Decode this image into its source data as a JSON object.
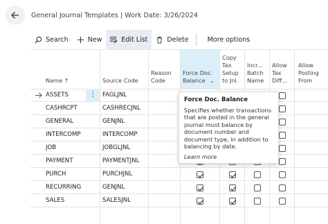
{
  "header": {
    "title": "General Journal Templates | Work Date: 3/26/2024"
  },
  "actions": {
    "search": "Search",
    "new": "New",
    "edit_list": "Edit List",
    "delete": "Delete",
    "more_options": "More options"
  },
  "columns": {
    "name": "Name ↑",
    "source_code": "Source Code",
    "reason_code_1": "Reason",
    "reason_code_2": "Code",
    "force_1": "Force Doc.",
    "force_2": "Balance",
    "copy_1": "Copy",
    "copy_2": "Tax",
    "copy_3": "Setup",
    "copy_4": "to Jnl.",
    "incr_1": "Incr...",
    "incr_2": "Batch",
    "incr_3": "Name",
    "allow_tax_1": "Allow",
    "allow_tax_2": "Tax",
    "allow_tax_3": "Diff...",
    "allow_post_1": "Allow",
    "allow_post_2": "Posting",
    "allow_post_3": "From"
  },
  "rows": [
    {
      "name": "ASSETS",
      "source": "FAGLJNL",
      "force": true,
      "copy": false,
      "incr": false,
      "tax": false
    },
    {
      "name": "CASHRCPT",
      "source": "CASHRECJNL",
      "force": true,
      "copy": false,
      "incr": false,
      "tax": false
    },
    {
      "name": "GENERAL",
      "source": "GENJNL",
      "force": true,
      "copy": false,
      "incr": false,
      "tax": false
    },
    {
      "name": "INTERCOMP",
      "source": "INTERCOMP",
      "force": true,
      "copy": false,
      "incr": false,
      "tax": false
    },
    {
      "name": "JOB",
      "source": "JOBGLJNL",
      "force": true,
      "copy": false,
      "incr": false,
      "tax": false
    },
    {
      "name": "PAYMENT",
      "source": "PAYMENTJNL",
      "force": true,
      "copy": false,
      "incr": false,
      "tax": false
    },
    {
      "name": "PURCH",
      "source": "PURCHJNL",
      "force": true,
      "copy": true,
      "incr": false,
      "tax": false
    },
    {
      "name": "RECURRING",
      "source": "GENJNL",
      "force": true,
      "copy": true,
      "incr": false,
      "tax": false
    },
    {
      "name": "SALES",
      "source": "SALESJNL",
      "force": true,
      "copy": true,
      "incr": false,
      "tax": false
    }
  ],
  "tooltip": {
    "title": "Force Doc. Balance",
    "body": "Specifies whether transactions that are posted in the general journal must balance by document number and document type, in addition to balancing by date.",
    "link": "Learn more"
  },
  "colors": {
    "selected_header": "#dbeefa",
    "grid_line": "#e3e3e3",
    "accent": "#0078d4"
  }
}
